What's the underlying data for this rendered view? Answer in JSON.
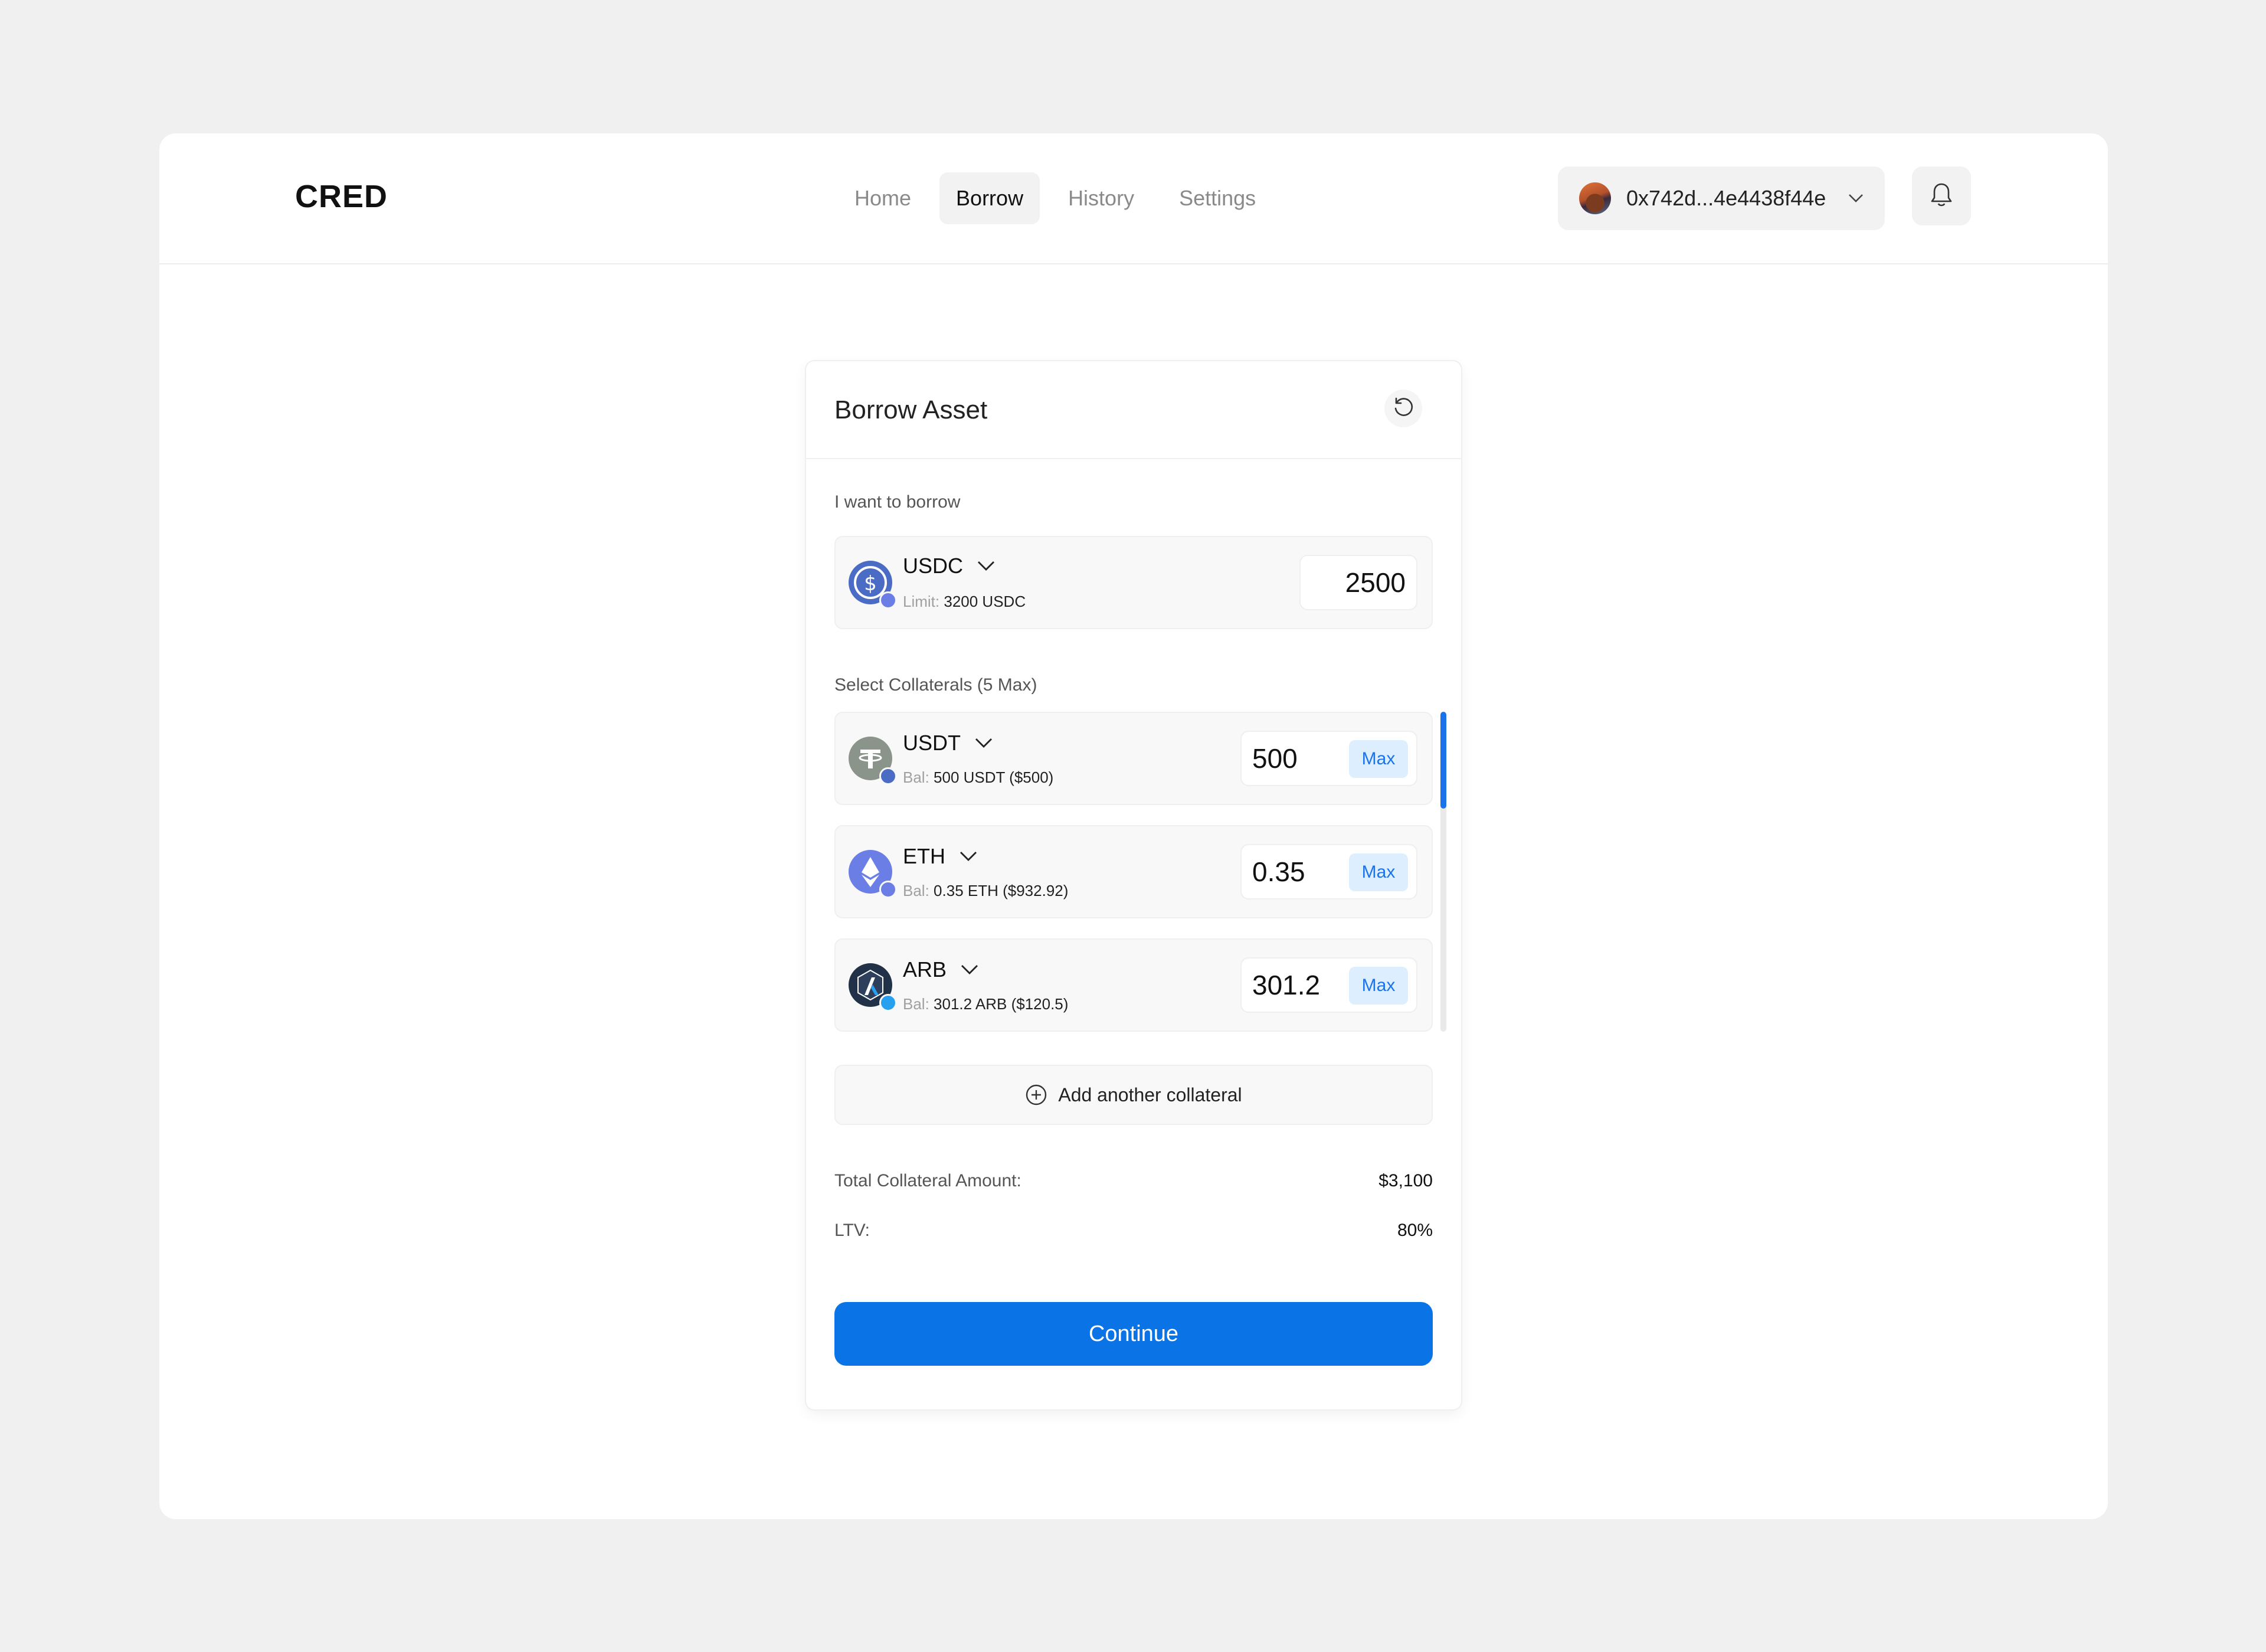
{
  "header": {
    "logo": "CRED",
    "nav": [
      {
        "label": "Home",
        "active": false
      },
      {
        "label": "Borrow",
        "active": true
      },
      {
        "label": "History",
        "active": false
      },
      {
        "label": "Settings",
        "active": false
      }
    ],
    "wallet_address": "0x742d...4e4438f44e",
    "icons": {
      "wallet_chevron": "chevron-down-icon",
      "notifications": "bell-icon"
    }
  },
  "card": {
    "title": "Borrow Asset",
    "refresh_icon": "refresh-icon",
    "borrow_label": "I want to borrow",
    "borrow": {
      "asset": "USDC",
      "limit_label": "Limit:",
      "limit_value": "3200 USDC",
      "amount": "2500",
      "color": "#4a6cc4"
    },
    "collateral_label": "Select Collaterals (5 Max)",
    "collaterals": [
      {
        "asset": "USDT",
        "bal_label": "Bal:",
        "bal_value": "500 USDT ($500)",
        "amount": "500",
        "max_label": "Max",
        "color": "#8a948a"
      },
      {
        "asset": "ETH",
        "bal_label": "Bal:",
        "bal_value": "0.35 ETH ($932.92)",
        "amount": "0.35",
        "max_label": "Max",
        "color": "#6b7ee6"
      },
      {
        "asset": "ARB",
        "bal_label": "Bal:",
        "bal_value": "301.2 ARB ($120.5)",
        "amount": "301.2",
        "max_label": "Max",
        "color": "#213147"
      }
    ],
    "add_collateral_label": "Add another collateral",
    "summary": {
      "total_label": "Total Collateral Amount:",
      "total_value": "$3,100",
      "ltv_label": "LTV:",
      "ltv_value": "80%"
    },
    "continue_label": "Continue"
  },
  "colors": {
    "accent": "#0a73e6",
    "max_bg": "#ddeeff",
    "background": "#f0f0f0"
  }
}
